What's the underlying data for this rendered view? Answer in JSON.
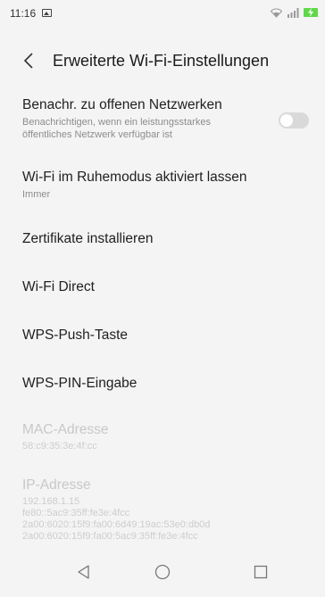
{
  "status_bar": {
    "time": "11:16",
    "battery_color": "#5fd84a"
  },
  "header": {
    "title": "Erweiterte Wi-Fi-Einstellungen",
    "back_icon": "chevron-left-icon"
  },
  "settings": [
    {
      "title": "Benachr. zu offenen Netzwerken",
      "subtitle": "Benachrichtigen, wenn ein leistungsstarkes öffentliches Netzwerk verfügbar ist",
      "toggle_on": false
    },
    {
      "title": "Wi-Fi im Ruhemodus aktiviert lassen",
      "subtitle": "Immer"
    },
    {
      "title": "Zertifikate installieren"
    },
    {
      "title": "Wi-Fi Direct"
    },
    {
      "title": "WPS-Push-Taste"
    },
    {
      "title": "WPS-PIN-Eingabe"
    }
  ],
  "mac": {
    "title": "MAC-Adresse",
    "value": "58:c9:35:3e:4f:cc"
  },
  "ip": {
    "title": "IP-Adresse",
    "values": [
      "192.168.1.15",
      "fe80::5ac9:35ff:fe3e:4fcc",
      "2a00:6020:15f9:fa00:6d49:19ac:53e0:db0d",
      "2a00:6020:15f9:fa00:5ac9:35ff:fe3e:4fcc"
    ]
  },
  "nav_bar": {
    "back_icon": "triangle-back-icon",
    "home_icon": "circle-home-icon",
    "recents_icon": "square-recents-icon"
  }
}
